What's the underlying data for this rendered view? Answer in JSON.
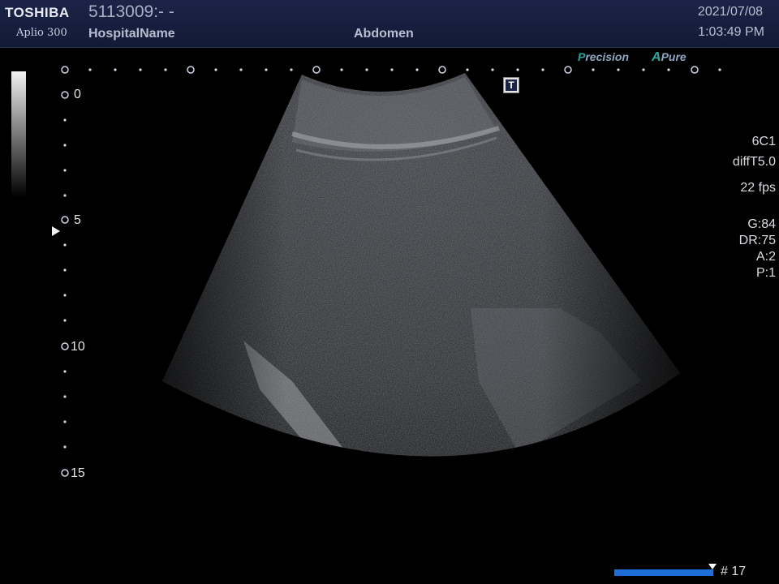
{
  "header": {
    "brand": "TOSHIBA",
    "model": "Aplio 300",
    "patient_id": "5113009:- -",
    "hospital": "HospitalName",
    "exam": "Abdomen",
    "date": "2021/07/08",
    "time": "1:03:49 PM"
  },
  "branding": {
    "precision_initial": "P",
    "precision_rest": "recision",
    "apure_initial": "A",
    "apure_rest": "Pure"
  },
  "depth_scale": {
    "labels": [
      "0",
      "5",
      "10",
      "15"
    ]
  },
  "marker_t": "T",
  "params": {
    "probe": "6C1",
    "mode": "diffT5.0",
    "frame_rate": "22 fps",
    "gain": "G:84",
    "dynamic_range": "DR:75",
    "a": "A:2",
    "p": "P:1"
  },
  "cine": {
    "frame_label": "# 17"
  },
  "colors": {
    "header_bg": "#1b2447",
    "accent_teal": "#2aa7a0",
    "cine_bar": "#1f6fd8"
  }
}
